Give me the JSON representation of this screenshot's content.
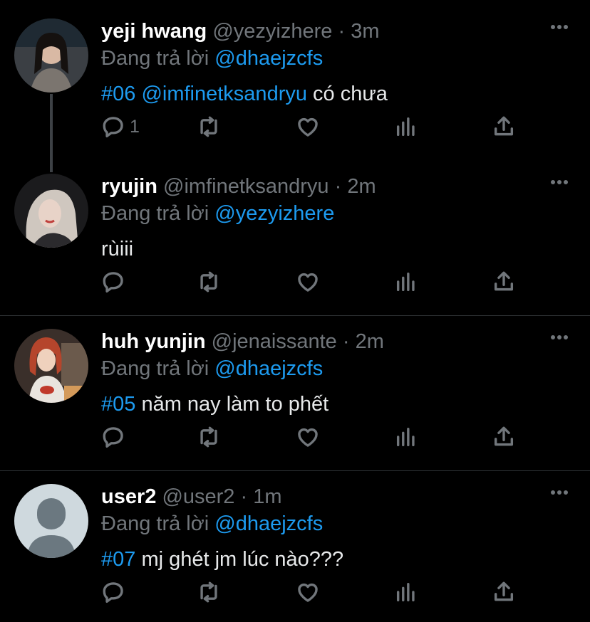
{
  "reply_prefix": "Đang trả lời",
  "tweets": [
    {
      "name": "yeji hwang",
      "handle": "@yezyizhere",
      "time": "3m",
      "reply_to": "@dhaejzcfs",
      "tag": "#06",
      "mention": "@imfinetksandryu",
      "text": " có chưa",
      "reply_count": "1"
    },
    {
      "name": "ryujin",
      "handle": "@imfinetksandryu",
      "time": "2m",
      "reply_to": "@yezyizhere",
      "tag": "",
      "mention": "",
      "text": "rùiii",
      "reply_count": ""
    },
    {
      "name": "huh yunjin",
      "handle": "@jenaissante",
      "time": "2m",
      "reply_to": "@dhaejzcfs",
      "tag": "#05",
      "mention": "",
      "text": " năm nay làm to phết",
      "reply_count": ""
    },
    {
      "name": "user2",
      "handle": "@user2",
      "time": "1m",
      "reply_to": "@dhaejzcfs",
      "tag": "#07",
      "mention": "",
      "text": " mj ghét jm lúc nào???",
      "reply_count": ""
    }
  ],
  "colors": {
    "background": "#000000",
    "link": "#1d9bf0",
    "muted": "#71767b",
    "divider": "#2f3336"
  },
  "icons": [
    "reply-icon",
    "retweet-icon",
    "like-icon",
    "analytics-icon",
    "share-icon",
    "more-icon"
  ]
}
